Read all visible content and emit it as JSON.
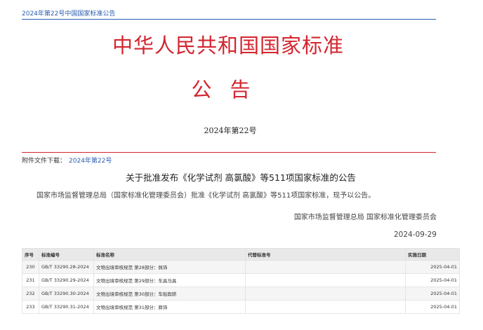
{
  "breadcrumb": "2024年第22号中国国家标准公告",
  "header": {
    "title": "中华人民共和国国家标准",
    "notice": "公告",
    "issue": "2024年第22号"
  },
  "attachments": {
    "label": "附件文件下载：",
    "link": "2024年第22号"
  },
  "announcement": {
    "headline": "关于批准发布《化学试剂 高氯酸》等511项国家标准的公告",
    "body": "国家市场监督管理总局（国家标准化管理委员会）批准《化学试剂 高氯酸》等511项国家标准，现予以公告。",
    "signer": "国家市场监督管理总局 国家标准化管理委员会",
    "date": "2024-09-29"
  },
  "table": {
    "headers": [
      "序号",
      "标准编号",
      "标准名称",
      "代替标准号",
      "实施日期"
    ],
    "rows": [
      [
        "230",
        "GB/T 33290.28-2024",
        "文物出境审核规范 第28部分：佩饰",
        "",
        "2025-04-01"
      ],
      [
        "231",
        "GB/T 33290.29-2024",
        "文物出境审核规范 第29部分：车具马具",
        "",
        "2025-04-01"
      ],
      [
        "232",
        "GB/T 33290.30-2024",
        "文物出境审核规范 第30部分：车船舆轿",
        "",
        "2025-04-01"
      ],
      [
        "233",
        "GB/T 33290.31-2024",
        "文物出境审核规范 第31部分：葬饰",
        "",
        "2025-04-01"
      ]
    ]
  },
  "colors": {
    "accent_red": "#d4252f",
    "link_blue": "#2a5db0"
  }
}
